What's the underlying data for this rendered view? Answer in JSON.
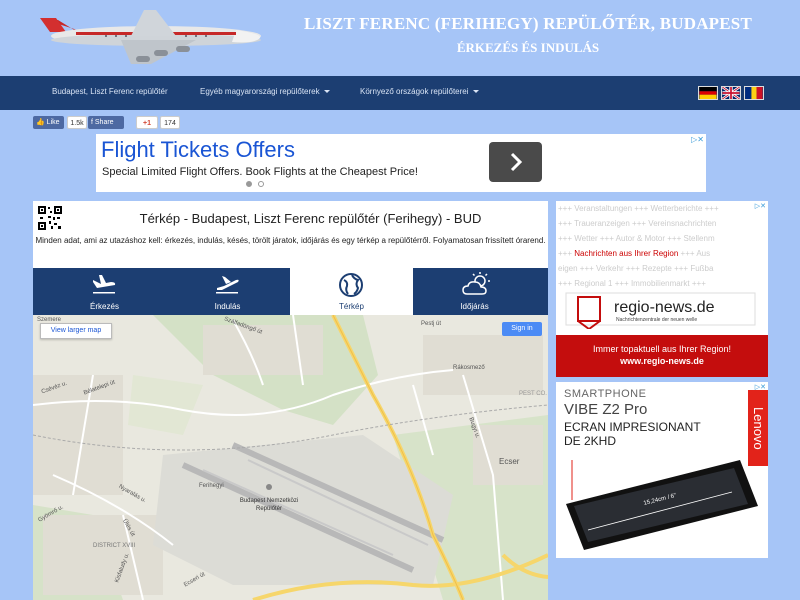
{
  "header": {
    "title": "LISZT FERENC (FERIHEGY) REPÜLŐTÉR, BUDAPEST",
    "subtitle": "ÉRKEZÉS ÉS INDULÁS"
  },
  "nav": {
    "items": [
      {
        "label": "Budapest, Liszt Ferenc repülőtér",
        "dropdown": false
      },
      {
        "label": "Egyéb magyarországi repülőterek",
        "dropdown": true
      },
      {
        "label": "Környező országok repülőterei",
        "dropdown": true
      }
    ],
    "flags": [
      "german-flag",
      "uk-flag",
      "romanian-flag"
    ]
  },
  "social": {
    "like": "Like",
    "like_count": "1.5k",
    "share": "Share",
    "gplus": "+1",
    "gplus_count": "174"
  },
  "ad_banner": {
    "title": "Flight Tickets Offers",
    "subtitle": "Special Limited Flight Offers. Book Flights at the Cheapest Price!"
  },
  "panel": {
    "title": "Térkép - Budapest, Liszt Ferenc repülőtér (Ferihegy) - BUD",
    "description": "Minden adat, ami az utazáshoz kell: érkezés, indulás, késés, törölt járatok, időjárás és egy térkép a repülőtérről. Folyamatosan frissített órarend.",
    "tabs": [
      {
        "label": "Érkezés",
        "icon": "arrival-plane-icon",
        "active": false
      },
      {
        "label": "Indulás",
        "icon": "departure-plane-icon",
        "active": false
      },
      {
        "label": "Térkép",
        "icon": "globe-icon",
        "active": true
      },
      {
        "label": "Időjárás",
        "icon": "weather-icon",
        "active": false
      }
    ]
  },
  "map": {
    "larger_link": "View larger map",
    "signin": "Sign in",
    "labels": [
      "Szemere",
      "Szálfadöngő út",
      "Pestj út",
      "Csévéz u.",
      "Bélatelepi út",
      "Rákosmező",
      "Bugyi u.",
      "Ecser",
      "Ferihegyi",
      "Nyaralás u.",
      "Gyömrő u.",
      "DISTRICT XVIII",
      "Ülés út",
      "Kisfaludy u.",
      "Ecseri út",
      "PEST CO."
    ],
    "airport_name": "Budapest Nemzetközi Repülőtér",
    "airport_short": "FERIHEGY"
  },
  "ad_right_1": {
    "ticker_lines": [
      "+++ Veranstaltungen +++ Wetterberichte +++",
      "+++ Traueranzeigen +++ Vereinsnachrichten",
      "+++ Wetter +++ Autor & Motor +++ Stellenm",
      "+++ Nachrichten aus Ihrer Region +++ Aus",
      "eigen +++ Verkehr +++ Rezepte +++ Fußba",
      "+++ Regional 1 +++ Immobilienmarkt +++"
    ],
    "highlight": "Nachrichten aus Ihrer Region",
    "brand": "regio-news.de",
    "brand_sub": "Nachrichtenzentrale der neuen welle",
    "footer": "Immer topaktuell aus Ihrer Region!",
    "footer_url": "www.regio-news.de"
  },
  "ad_right_2": {
    "line1": "SMARTPHONE",
    "line2": "VIBE Z2 Pro",
    "line3": "ECRAN IMPRESIONANT",
    "line4": "DE 2KHD",
    "brand": "Lenovo",
    "size_label": "15,24cm / 6\""
  },
  "colors": {
    "background": "#a6c5f7",
    "navbar": "#1c3e72",
    "ad_red": "#c40d0d",
    "lenovo_red": "#e2231a"
  }
}
